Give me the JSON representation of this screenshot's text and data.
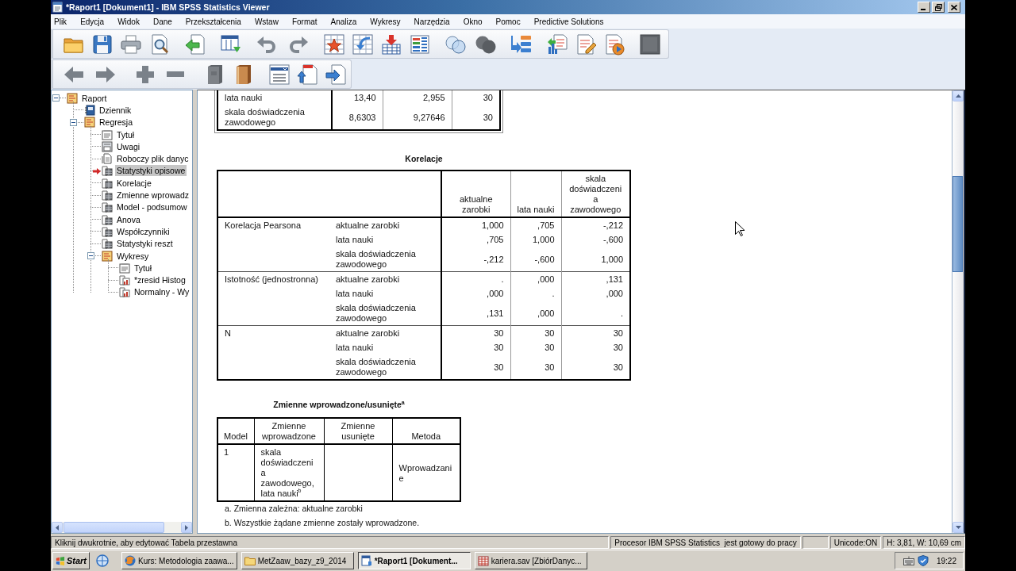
{
  "window": {
    "title": "*Raport1 [Dokument1] - IBM SPSS Statistics Viewer"
  },
  "menu": [
    "Plik",
    "Edycja",
    "Widok",
    "Dane",
    "Przekształcenia",
    "Wstaw",
    "Format",
    "Analiza",
    "Wykresy",
    "Narzędzia",
    "Okno",
    "Pomoc",
    "Predictive Solutions"
  ],
  "outline": {
    "items": [
      {
        "label": "Raport",
        "kind": "heading",
        "selected": false,
        "expanded": true,
        "children": [
          {
            "label": "Dziennik",
            "kind": "log",
            "selected": false
          },
          {
            "label": "Regresja",
            "kind": "heading",
            "selected": false,
            "expanded": true,
            "children": [
              {
                "label": "Tytuł",
                "kind": "title",
                "selected": false
              },
              {
                "label": "Uwagi",
                "kind": "notes",
                "selected": false
              },
              {
                "label": "Roboczy plik danyc",
                "kind": "dataset",
                "selected": false
              },
              {
                "label": "Statystyki opisowe",
                "kind": "table",
                "selected": true
              },
              {
                "label": "Korelacje",
                "kind": "table",
                "selected": false
              },
              {
                "label": "Zmienne wprowadz",
                "kind": "table",
                "selected": false
              },
              {
                "label": "Model - podsumow",
                "kind": "table",
                "selected": false
              },
              {
                "label": "Anova",
                "kind": "table",
                "selected": false
              },
              {
                "label": "Współczynniki",
                "kind": "table",
                "selected": false
              },
              {
                "label": "Statystyki reszt",
                "kind": "table",
                "selected": false
              },
              {
                "label": "Wykresy",
                "kind": "heading",
                "selected": false,
                "expanded": true,
                "children": [
                  {
                    "label": "Tytuł",
                    "kind": "title",
                    "selected": false
                  },
                  {
                    "label": "*zresid Histog",
                    "kind": "chart",
                    "selected": false
                  },
                  {
                    "label": "Normalny - Wy",
                    "kind": "chart",
                    "selected": false
                  }
                ]
              }
            ]
          }
        ]
      }
    ]
  },
  "output": {
    "descriptives": {
      "selected": true,
      "rows": [
        {
          "label": "lata nauki",
          "cells": [
            "13,40",
            "2,955",
            "30"
          ]
        },
        {
          "label": "skala doświadczenia zawodowego",
          "cells": [
            "8,6303",
            "9,27646",
            "30"
          ]
        }
      ]
    },
    "correlations": {
      "title": "Korelacje",
      "selected": false,
      "columns": [
        "aktualne zarobki",
        "lata nauki",
        "skala doświadczenia zawodowego"
      ],
      "groups": [
        {
          "label": "Korelacja Pearsona",
          "rows": [
            {
              "label": "aktualne zarobki",
              "cells": [
                "1,000",
                ",705",
                "-,212"
              ]
            },
            {
              "label": "lata nauki",
              "cells": [
                ",705",
                "1,000",
                "-,600"
              ]
            },
            {
              "label": "skala doświadczenia zawodowego",
              "cells": [
                "-,212",
                "-,600",
                "1,000"
              ]
            }
          ]
        },
        {
          "label": "Istotność (jednostronna)",
          "rows": [
            {
              "label": "aktualne zarobki",
              "cells": [
                ".",
                ",000",
                ",131"
              ]
            },
            {
              "label": "lata nauki",
              "cells": [
                ",000",
                ".",
                ",000"
              ]
            },
            {
              "label": "skala doświadczenia zawodowego",
              "cells": [
                ",131",
                ",000",
                "."
              ]
            }
          ]
        },
        {
          "label": "N",
          "rows": [
            {
              "label": "aktualne zarobki",
              "cells": [
                "30",
                "30",
                "30"
              ]
            },
            {
              "label": "lata nauki",
              "cells": [
                "30",
                "30",
                "30"
              ]
            },
            {
              "label": "skala doświadczenia zawodowego",
              "cells": [
                "30",
                "30",
                "30"
              ]
            }
          ]
        }
      ]
    },
    "variables_entered": {
      "title": "Zmienne wprowadzone/usunięte$^{a}$",
      "selected": false,
      "columns": [
        "Model",
        "Zmienne wprowadzone",
        "Zmienne usunięte",
        "Metoda"
      ],
      "rows": [
        {
          "model": "1",
          "entered": "skala doświadczenia zawodowego, lata nauki$^{b}$",
          "method": "Wprowadzanie"
        }
      ],
      "footnotes": [
        "a. Zmienna zależna: aktualne zarobki",
        "b. Wszystkie żądane zmienne zostały wprowadzone."
      ]
    }
  },
  "status_bar": {
    "message": "Kliknij dwukrotnie, aby edytować Tabela przestawna",
    "state": "Procesor IBM SPSS Statistics  jest gotowy do pracy",
    "encoding": "Unicode:ON",
    "dimensions": "H: 3,81, W: 10,69 cm"
  },
  "taskbar": {
    "start": "Start",
    "tasks": [
      {
        "label": "Kurs: Metodologia zaawa...",
        "kind": "browser",
        "selected": false
      },
      {
        "label": "MetZaaw_bazy_z9_2014",
        "kind": "folder",
        "selected": false
      },
      {
        "label": "*Raport1 [Dokument...",
        "kind": "viewer",
        "selected": true
      },
      {
        "label": "kariera.sav [ZbiórDanyc...",
        "kind": "data",
        "selected": false
      }
    ],
    "clock": "19:22"
  }
}
